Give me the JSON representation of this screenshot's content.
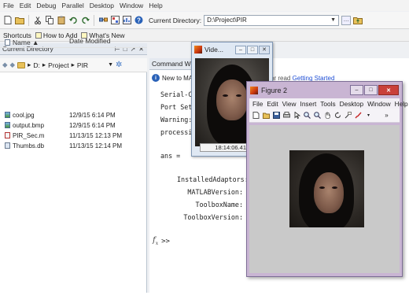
{
  "menu": [
    "File",
    "Edit",
    "Debug",
    "Parallel",
    "Desktop",
    "Window",
    "Help"
  ],
  "toolbar": {
    "current_dir_label": "Current Directory:",
    "current_dir_value": "D:\\Project\\PIR"
  },
  "shortcuts": {
    "label": "Shortcuts",
    "how_to_add": "How to Add",
    "whats_new": "What's New"
  },
  "current_directory": {
    "title": "Current Directory",
    "path": [
      "D:",
      "Project",
      "PIR"
    ],
    "columns": {
      "name": "Name ▲",
      "date": "Date Modified"
    },
    "files": [
      {
        "name": "cool.jpg",
        "date": "12/9/15 6:14 PM",
        "icon": "image-file-icon"
      },
      {
        "name": "output.bmp",
        "date": "12/9/15 6:14 PM",
        "icon": "image-file-icon"
      },
      {
        "name": "PIR_Sec.m",
        "date": "11/13/15 12:13 PM",
        "icon": "m-file-icon"
      },
      {
        "name": "Thumbs.db",
        "date": "11/13/15 12:14 PM",
        "icon": "db-file-icon"
      }
    ]
  },
  "command_window": {
    "title": "Command Win",
    "info": "New to MAT",
    "info_suffix": "or read",
    "getting_started": "Getting Started",
    "lines": [
      "Serial-C",
      "Port Set",
      "Warning:",
      "processi"
    ],
    "ans": "ans =",
    "fields": [
      "InstalledAdaptors:",
      "MATLABVersion:",
      "ToolboxName:",
      "ToolboxVersion:"
    ],
    "prompt": ">>"
  },
  "video_window": {
    "title": "Vide...",
    "timestamp": "18:14:06.411"
  },
  "figure_window": {
    "title": "Figure 2",
    "menu": [
      "File",
      "Edit",
      "View",
      "Insert",
      "Tools",
      "Desktop",
      "Window",
      "Help"
    ]
  }
}
